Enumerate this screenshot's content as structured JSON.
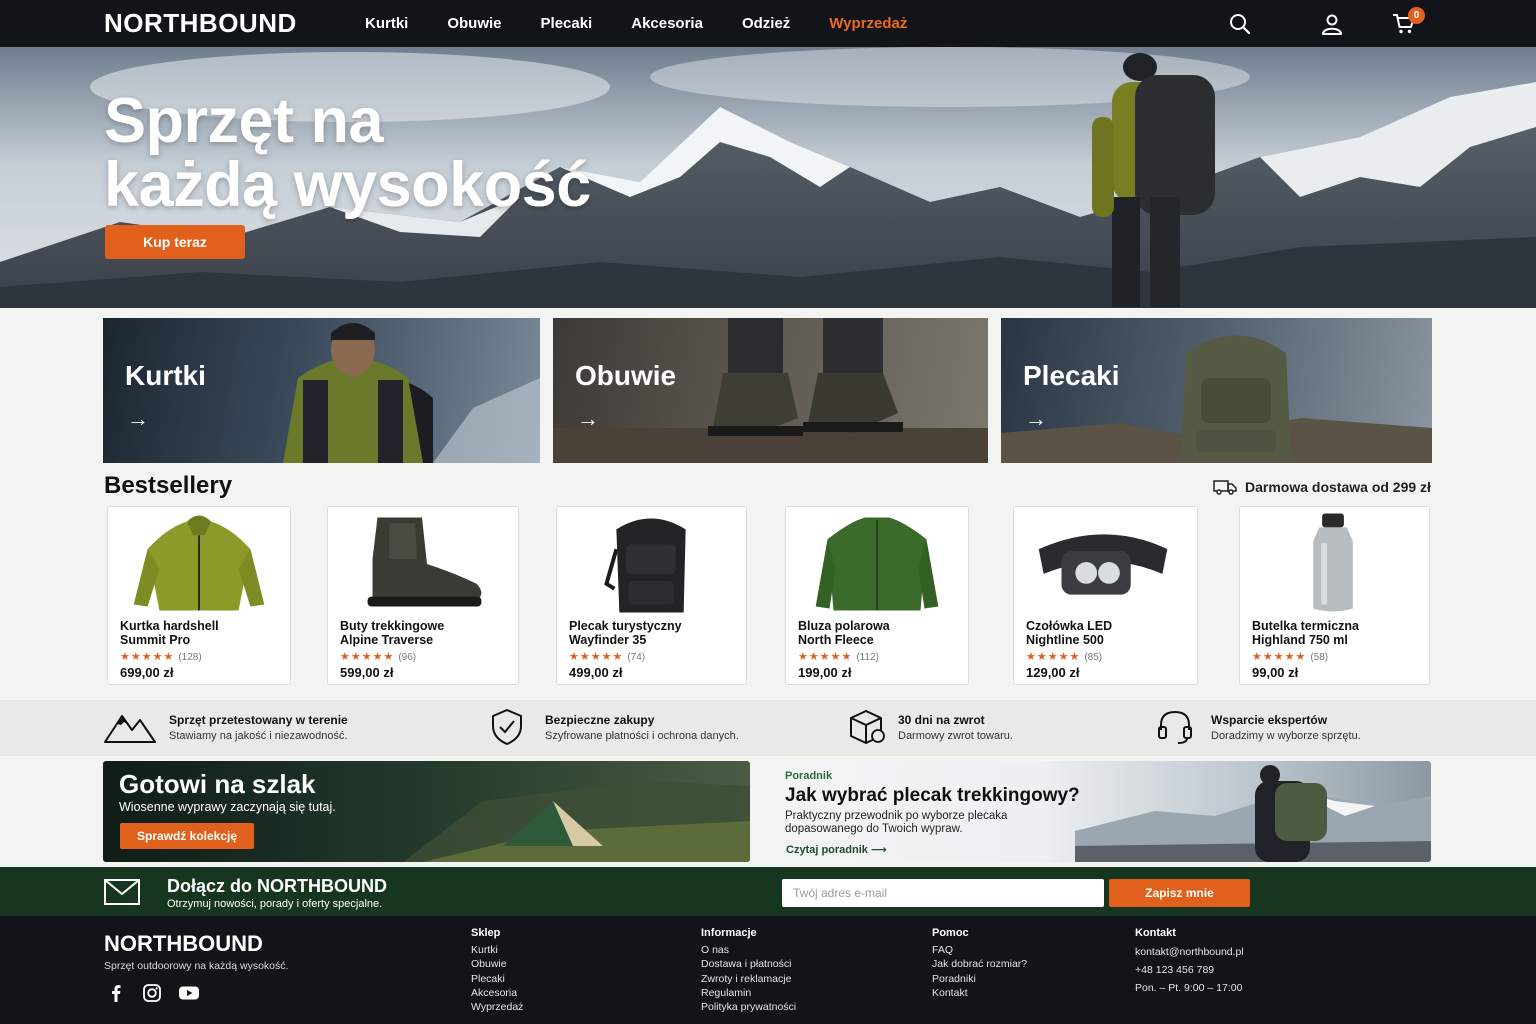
{
  "brand": {
    "name": "NORTHBOUND",
    "accent": "#e0601c",
    "dark": "#111418",
    "green": "#16361f"
  },
  "nav": {
    "links": [
      "Kurtki",
      "Obuwie",
      "Plecaki",
      "Akcesoria",
      "Odzież",
      "Wyprzedaż"
    ],
    "icons": [
      "search-icon",
      "user-icon",
      "cart-icon"
    ],
    "cart_count": "0"
  },
  "hero": {
    "title_line1": "Sprzęt na",
    "title_line2": "każdą wysokość",
    "cta": "Kup teraz"
  },
  "categories": [
    {
      "title": "Kurtki",
      "arrow": "→"
    },
    {
      "title": "Obuwie",
      "arrow": "→"
    },
    {
      "title": "Plecaki",
      "arrow": "→"
    }
  ],
  "bestsellers": {
    "title": "Bestsellery",
    "delivery": "Darmowa dostawa od 299 zł",
    "products": [
      {
        "name_line1": "Kurtka hardshell",
        "name_line2": "Summit Pro",
        "stars": "★★★★★",
        "count": "(128)",
        "price": "699,00 zł",
        "icon": "jacket-image"
      },
      {
        "name_line1": "Buty trekkingowe",
        "name_line2": "Alpine Traverse",
        "stars": "★★★★★",
        "count": "(96)",
        "price": "599,00 zł",
        "icon": "boot-image"
      },
      {
        "name_line1": "Plecak turystyczny",
        "name_line2": "Wayfinder 35",
        "stars": "★★★★★",
        "count": "(74)",
        "price": "499,00 zł",
        "icon": "backpack-image"
      },
      {
        "name_line1": "Bluza polarowa",
        "name_line2": "North Fleece",
        "stars": "★★★★★",
        "count": "(112)",
        "price": "199,00 zł",
        "icon": "fleece-image"
      },
      {
        "name_line1": "Czołówka LED",
        "name_line2": "Nightline 500",
        "stars": "★★★★★",
        "count": "(85)",
        "price": "129,00 zł",
        "icon": "headlamp-image"
      },
      {
        "name_line1": "Butelka termiczna",
        "name_line2": "Highland 750 ml",
        "stars": "★★★★★",
        "count": "(58)",
        "price": "99,00 zł",
        "icon": "bottle-image"
      }
    ]
  },
  "features": [
    {
      "title": "Sprzęt przetestowany w terenie",
      "sub": "Stawiamy na jakość i niezawodność.",
      "icon": "mountain-icon"
    },
    {
      "title": "Bezpieczne zakupy",
      "sub": "Szyfrowane płatności i ochrona danych.",
      "icon": "shield-check-icon"
    },
    {
      "title": "30 dni na zwrot",
      "sub": "Darmowy zwrot towaru.",
      "icon": "box-return-icon"
    },
    {
      "title": "Wsparcie ekspertów",
      "sub": "Doradzimy w wyborze sprzętu.",
      "icon": "headset-icon"
    }
  ],
  "promo_trail": {
    "title": "Gotowi na szlak",
    "sub": "Wiosenne wyprawy zaczynają się tutaj.",
    "cta": "Sprawdź kolekcję"
  },
  "promo_guide": {
    "tag": "Poradnik",
    "title": "Jak wybrać plecak trekkingowy?",
    "sub": "Praktyczny przewodnik po wyborze plecaka dopasowanego do Twoich wypraw.",
    "link": "Czytaj poradnik ⟶"
  },
  "newsletter": {
    "title": "Dołącz do NORTHBOUND",
    "sub": "Otrzymuj nowości, porady i oferty specjalne.",
    "placeholder": "Twój adres e-mail",
    "cta": "Zapisz mnie"
  },
  "footer": {
    "tagline": "Sprzęt outdoorowy na każdą wysokość.",
    "social": [
      "facebook-icon",
      "instagram-icon",
      "youtube-icon"
    ],
    "columns": [
      {
        "title": "Sklep",
        "items": [
          "Kurtki",
          "Obuwie",
          "Plecaki",
          "Akcesoria",
          "Wyprzedaż"
        ]
      },
      {
        "title": "Informacje",
        "items": [
          "O nas",
          "Dostawa i płatności",
          "Zwroty i reklamacje",
          "Regulamin",
          "Polityka prywatności"
        ]
      },
      {
        "title": "Pomoc",
        "items": [
          "FAQ",
          "Jak dobrać rozmiar?",
          "Poradniki",
          "Kontakt"
        ]
      },
      {
        "title": "Kontakt",
        "items": [
          "kontakt@northbound.pl",
          "+48 123 456 789",
          "Pon. – Pt. 9:00 – 17:00"
        ]
      }
    ]
  }
}
